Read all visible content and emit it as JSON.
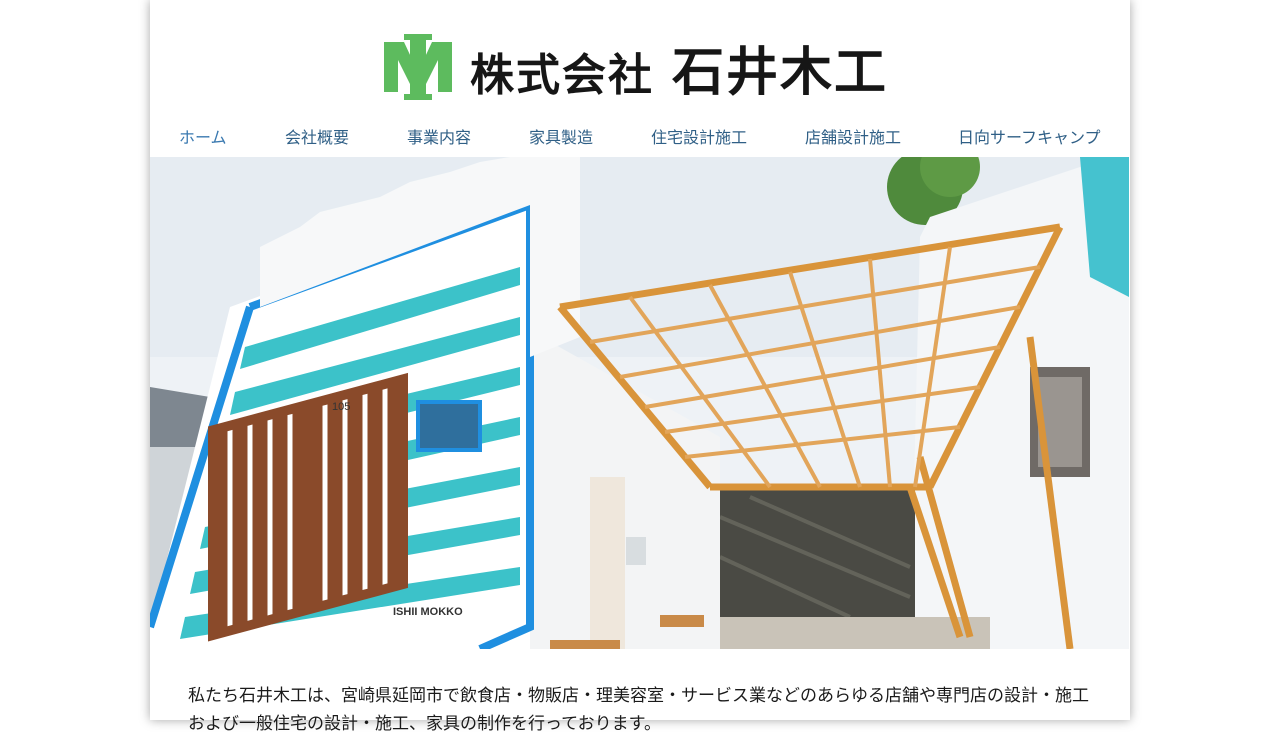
{
  "header": {
    "company_prefix": "株式会社",
    "company_name": "石井木工",
    "logo_mark": "IM"
  },
  "nav": {
    "items": [
      {
        "label": "ホーム",
        "active": true
      },
      {
        "label": "会社概要"
      },
      {
        "label": "事業内容"
      },
      {
        "label": "家具製造"
      },
      {
        "label": "住宅設計施工"
      },
      {
        "label": "店舗設計施工"
      },
      {
        "label": "日向サーフキャンプ"
      }
    ]
  },
  "hero": {
    "house_number": "105",
    "sign_text": "ISHII MOKKO"
  },
  "intro": {
    "text": "私たち石井木工は、宮崎県延岡市で飲食店・物販店・理美容室・サービス業などのあらゆる店舗や専門店の設計・施工および一般住宅の設計・施工、家具の制作を行っております。"
  },
  "colors": {
    "logo_green": "#5dbb5e",
    "nav_text": "#2f5f86",
    "stripe_teal": "#3cc2c9",
    "frame_blue": "#1f8fe0",
    "wood": "#d9943a"
  }
}
